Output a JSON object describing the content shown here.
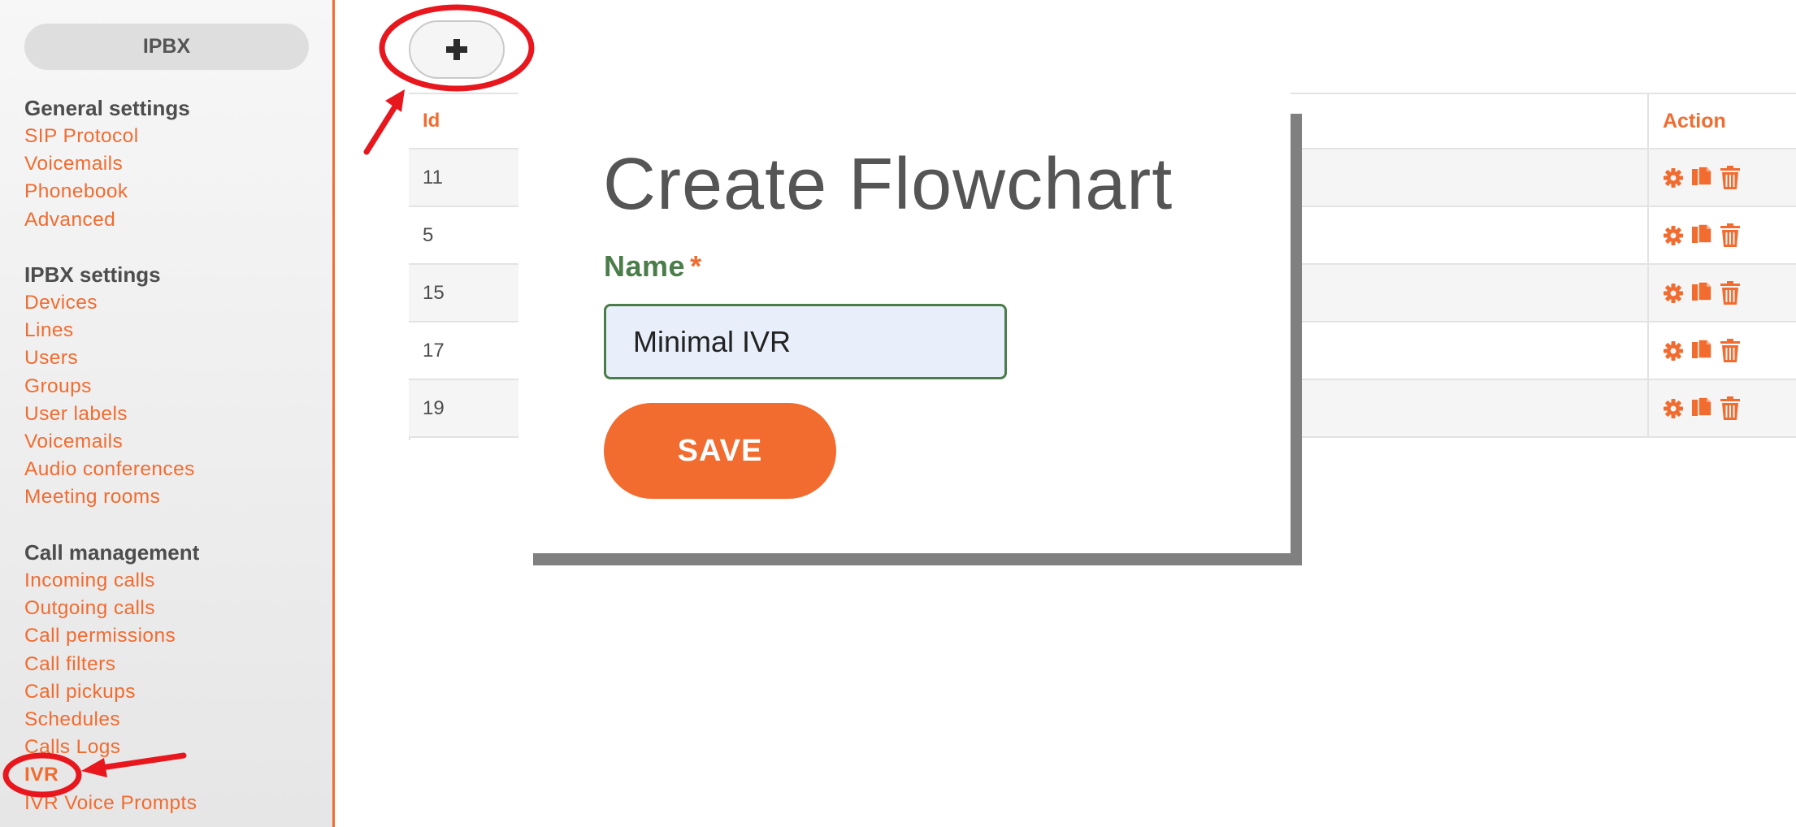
{
  "sidebar": {
    "ipbx_button": "IPBX",
    "groups": [
      {
        "title": "General settings",
        "items": [
          "SIP Protocol",
          "Voicemails",
          "Phonebook",
          "Advanced"
        ]
      },
      {
        "title": "IPBX settings",
        "items": [
          "Devices",
          "Lines",
          "Users",
          "Groups",
          "User labels",
          "Voicemails",
          "Audio conferences",
          "Meeting rooms"
        ]
      },
      {
        "title": "Call management",
        "items": [
          "Incoming calls",
          "Outgoing calls",
          "Call permissions",
          "Call filters",
          "Call pickups",
          "Schedules",
          "Calls Logs",
          "IVR",
          "IVR Voice Prompts"
        ]
      }
    ]
  },
  "toolbar": {
    "add_icon": "plus-icon"
  },
  "table": {
    "headers": {
      "id": "Id",
      "action": "Action"
    },
    "rows": [
      {
        "id": "11"
      },
      {
        "id": "5"
      },
      {
        "id": "15"
      },
      {
        "id": "17"
      },
      {
        "id": "19"
      }
    ],
    "action_icons": [
      "gear-icon",
      "copy-icon",
      "trash-icon"
    ]
  },
  "modal": {
    "title": "Create Flowchart",
    "name_label": "Name",
    "required_marker": "*",
    "name_value": "Minimal IVR",
    "save_label": "SAVE"
  },
  "colors": {
    "accent": "#f26b2f",
    "label_green": "#4b7d4b",
    "annotation_red": "#e8171d"
  }
}
